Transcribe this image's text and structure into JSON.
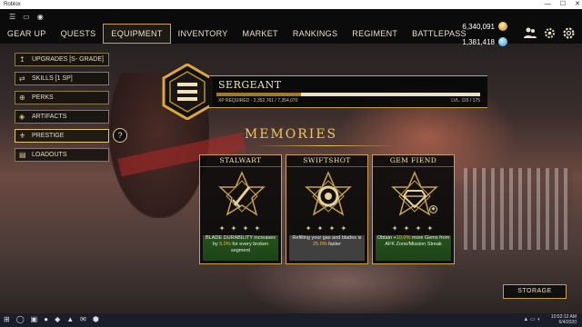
{
  "window": {
    "title": "Roblox",
    "controls": [
      "—",
      "☐",
      "✕"
    ]
  },
  "topbar_icons": [
    "☰",
    "▭",
    "◉"
  ],
  "tabs": [
    {
      "label": "GEAR UP",
      "active": false
    },
    {
      "label": "QUESTS",
      "active": false
    },
    {
      "label": "EQUIPMENT",
      "active": true
    },
    {
      "label": "INVENTORY",
      "active": false
    },
    {
      "label": "MARKET",
      "active": false
    },
    {
      "label": "RANKINGS",
      "active": false
    },
    {
      "label": "REGIMENT",
      "active": false
    },
    {
      "label": "BATTLEPASS",
      "active": false
    }
  ],
  "currency": {
    "gold": "6,340,091",
    "gems": "1,381,418",
    "gold_icon": "gold-coin-icon",
    "gems_icon": "gem-icon"
  },
  "topright_icons": [
    "group-icon",
    "settings-icon",
    "gear-icon"
  ],
  "sidebar": [
    {
      "label": "UPGRADES [S- GRADE]",
      "icon": "↥",
      "active": false
    },
    {
      "label": "SKILLS [1 SP]",
      "icon": "⇄",
      "active": false
    },
    {
      "label": "PERKS",
      "icon": "⊕",
      "active": false
    },
    {
      "label": "ARTIFACTS",
      "icon": "◈",
      "active": false
    },
    {
      "label": "PRESTIGE",
      "icon": "⚜",
      "active": true
    },
    {
      "label": "LOADOUTS",
      "icon": "▤",
      "active": false
    }
  ],
  "help_label": "?",
  "rank": {
    "title": "SERGEANT",
    "xp_text": "XP REQUIRED - 2,352,761 / 7,354,070",
    "level_text": "LVL. 115 / 175",
    "xp_fraction": 0.32
  },
  "memories_title": "MEMORIES",
  "cards": [
    {
      "title": "STALWART",
      "stars": "✦ ✦ ✦ ✦",
      "desc_pre": "BLADE DURABILITY increases by ",
      "desc_hl": "5.0%",
      "desc_post": " for every broken segment",
      "theme": "green"
    },
    {
      "title": "SWIFTSHOT",
      "stars": "✦ ✦ ✦ ✦",
      "desc_pre": "Refilling your gas and blades is ",
      "desc_hl": "25.0%",
      "desc_post": " faster",
      "theme": "gray"
    },
    {
      "title": "GEM FIEND",
      "stars": "✦ ✦ ✦ ✦",
      "desc_pre": "Obtain +",
      "desc_hl": "10.0%",
      "desc_post": " more Gems from AFK Zone/Mission Streak",
      "theme": "green"
    }
  ],
  "storage_label": "STORAGE",
  "taskbar": {
    "apps": [
      "⊞",
      "◯",
      "▣",
      "●",
      "◆",
      "▲",
      "✉",
      "⬢"
    ],
    "time": "10:52:12 AM",
    "date": "6/4/2020"
  }
}
